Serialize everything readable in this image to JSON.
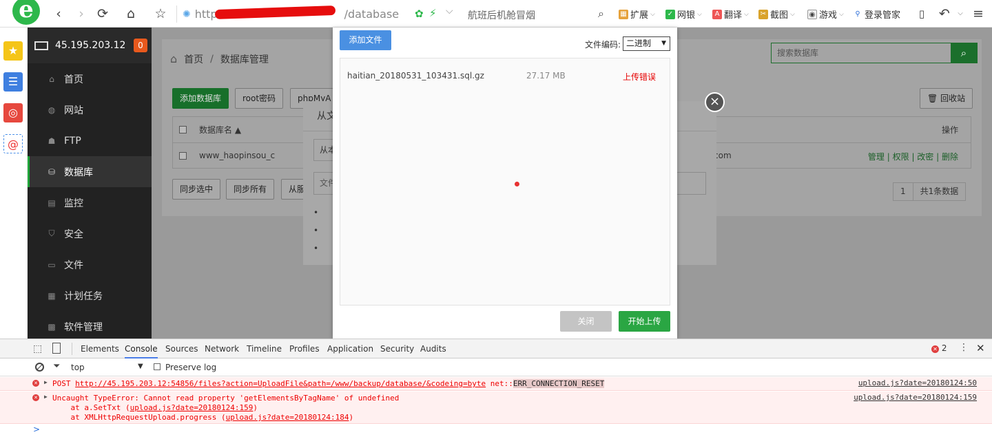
{
  "browser": {
    "url_prefix": "http",
    "url_suffix": "/database",
    "search_text": "航班后机舱冒烟",
    "extensions": [
      "扩展",
      "网银",
      "翻译",
      "截图",
      "游戏",
      "登录管家"
    ]
  },
  "sidebar": {
    "server_ip": "45.195.203.12",
    "badge": "0",
    "items": [
      "首页",
      "网站",
      "FTP",
      "数据库",
      "监控",
      "安全",
      "文件",
      "计划任务",
      "软件管理"
    ]
  },
  "main": {
    "crumb_home": "首页",
    "crumb_sep": "/",
    "crumb_page": "数据库管理",
    "search_placeholder": "搜索数据库",
    "buttons": [
      "添加数据库",
      "root密码",
      "phpMyA"
    ],
    "recycle": "回收站",
    "col_name": "数据库名 ▲",
    "col_ops": "操作",
    "row_name": "www_haopinsou_c",
    "row_tail": "com",
    "ops": [
      "管理",
      "权限",
      "改密",
      "删除"
    ],
    "bottom_buttons": [
      "同步选中",
      "同步所有",
      "从服"
    ],
    "pager_page": "1",
    "pager_total": "共1条数据"
  },
  "mid_modal": {
    "title": "从文",
    "select": "从本",
    "input": "文件",
    "bullets": [
      "•",
      "•",
      "•"
    ]
  },
  "upload": {
    "add_file": "添加文件",
    "encoding_label": "文件编码:",
    "encoding_value": "二进制",
    "file_name": "haitian_20180531_103431.sql.gz",
    "file_size": "27.17 MB",
    "file_status": "上传错误",
    "close": "关闭",
    "start": "开始上传"
  },
  "devtools": {
    "tabs": [
      "Elements",
      "Console",
      "Sources",
      "Network",
      "Timeline",
      "Profiles",
      "Application",
      "Security",
      "Audits"
    ],
    "error_count": "2",
    "context": "top",
    "preserve_log": "Preserve log",
    "msg1_method": "POST",
    "msg1_url": "http://45.195.203.12:54856/files?action=UploadFile&path=/www/backup/database/&codeing=byte",
    "msg1_net": "net::",
    "msg1_err": "ERR_CONNECTION_RESET",
    "msg1_src": "upload.js?date=20180124:50",
    "msg2_text": "Uncaught TypeError: Cannot read property 'getElementsByTagName' of undefined",
    "msg2_at1": "    at a.SetTxt (",
    "msg2_at1_link": "upload.js?date=20180124:159",
    "msg2_at1_end": ")",
    "msg2_at2": "    at XMLHttpRequestUpload.progress (",
    "msg2_at2_link": "upload.js?date=20180124:184",
    "msg2_at2_end": ")",
    "msg2_src": "upload.js?date=20180124:159",
    "prompt": ">"
  }
}
